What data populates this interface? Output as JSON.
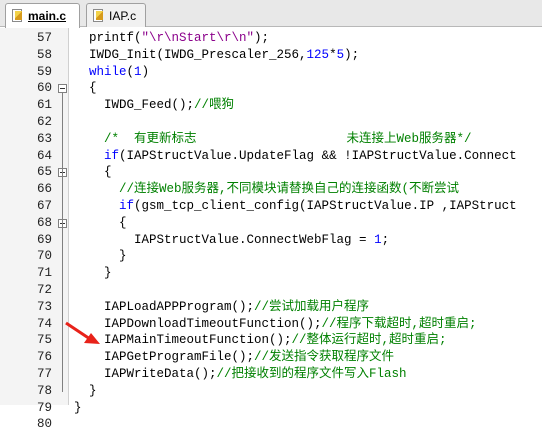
{
  "tabs": [
    {
      "label": "main.c",
      "active": true
    },
    {
      "label": "IAP.c",
      "active": false
    }
  ],
  "colors": {
    "keyword": "#0000ff",
    "string": "#8b008b",
    "number": "#0000ff",
    "comment": "#008000",
    "text": "#000000",
    "arrow": "#e8221a"
  },
  "lines": [
    {
      "n": "57",
      "tokens": [
        [
          "t",
          "  printf("
        ],
        [
          "s",
          "\"\\r\\nStart\\r\\n\""
        ],
        [
          "t",
          ");"
        ]
      ]
    },
    {
      "n": "58",
      "tokens": [
        [
          "t",
          "  IWDG_Init(IWDG_Prescaler_256,"
        ],
        [
          "n",
          "125"
        ],
        [
          "t",
          "*"
        ],
        [
          "n",
          "5"
        ],
        [
          "t",
          ");"
        ]
      ]
    },
    {
      "n": "59",
      "tokens": [
        [
          "t",
          "  "
        ],
        [
          "k",
          "while"
        ],
        [
          "t",
          "("
        ],
        [
          "n",
          "1"
        ],
        [
          "t",
          ")"
        ]
      ]
    },
    {
      "n": "60",
      "tokens": [
        [
          "t",
          "  {"
        ]
      ],
      "fold": true
    },
    {
      "n": "61",
      "tokens": [
        [
          "t",
          "    IWDG_Feed();"
        ],
        [
          "c",
          "//喂狗"
        ]
      ]
    },
    {
      "n": "62",
      "tokens": []
    },
    {
      "n": "63",
      "tokens": [
        [
          "t",
          "    "
        ],
        [
          "c",
          "/*  有更新标志                    未连接上Web服务器*/"
        ]
      ]
    },
    {
      "n": "64",
      "tokens": [
        [
          "t",
          "    "
        ],
        [
          "k",
          "if"
        ],
        [
          "t",
          "(IAPStructValue.UpdateFlag && !IAPStructValue.Connect"
        ]
      ]
    },
    {
      "n": "65",
      "tokens": [
        [
          "t",
          "    {"
        ]
      ],
      "fold": true
    },
    {
      "n": "66",
      "tokens": [
        [
          "t",
          "      "
        ],
        [
          "c",
          "//连接Web服务器,不同模块请替换自己的连接函数(不断尝试"
        ]
      ]
    },
    {
      "n": "67",
      "tokens": [
        [
          "t",
          "      "
        ],
        [
          "k",
          "if"
        ],
        [
          "t",
          "(gsm_tcp_client_config(IAPStructValue.IP ,IAPStruct"
        ]
      ]
    },
    {
      "n": "68",
      "tokens": [
        [
          "t",
          "      {"
        ]
      ],
      "fold": true
    },
    {
      "n": "69",
      "tokens": [
        [
          "t",
          "        IAPStructValue.ConnectWebFlag = "
        ],
        [
          "n",
          "1"
        ],
        [
          "t",
          ";"
        ]
      ]
    },
    {
      "n": "70",
      "tokens": [
        [
          "t",
          "      }"
        ]
      ]
    },
    {
      "n": "71",
      "tokens": [
        [
          "t",
          "    }"
        ]
      ]
    },
    {
      "n": "72",
      "tokens": []
    },
    {
      "n": "73",
      "tokens": [
        [
          "t",
          "    IAPLoadAPPProgram();"
        ],
        [
          "c",
          "//尝试加载用户程序"
        ]
      ]
    },
    {
      "n": "74",
      "tokens": [
        [
          "t",
          "    IAPDownloadTimeoutFunction();"
        ],
        [
          "c",
          "//程序下载超时,超时重启;"
        ]
      ]
    },
    {
      "n": "75",
      "tokens": [
        [
          "t",
          "    IAPMainTimeoutFunction();"
        ],
        [
          "c",
          "//整体运行超时,超时重启;"
        ]
      ]
    },
    {
      "n": "76",
      "tokens": [
        [
          "t",
          "    IAPGetProgramFile();"
        ],
        [
          "c",
          "//发送指令获取程序文件"
        ]
      ]
    },
    {
      "n": "77",
      "tokens": [
        [
          "t",
          "    IAPWriteData();"
        ],
        [
          "c",
          "//把接收到的程序文件写入Flash"
        ]
      ]
    },
    {
      "n": "78",
      "tokens": [
        [
          "t",
          "  }"
        ]
      ]
    },
    {
      "n": "79",
      "tokens": [
        [
          "t",
          "}"
        ]
      ]
    },
    {
      "n": "80",
      "tokens": []
    }
  ]
}
